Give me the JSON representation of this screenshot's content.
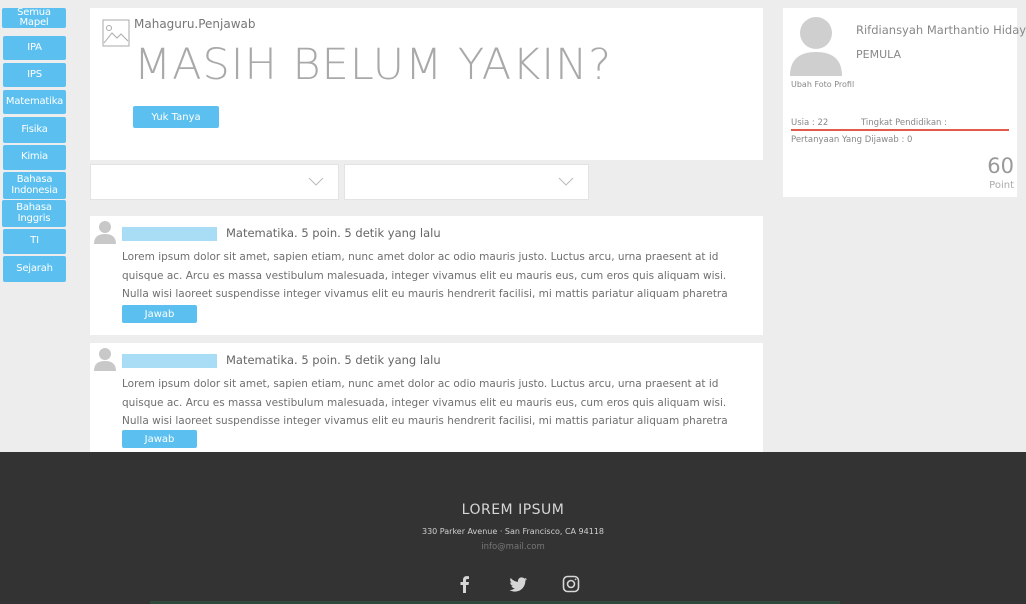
{
  "sidebar": {
    "items": [
      {
        "label": "Semua Mapel"
      },
      {
        "label": "IPA"
      },
      {
        "label": "IPS"
      },
      {
        "label": "Matematika"
      },
      {
        "label": "Fisika"
      },
      {
        "label": "Kimia"
      },
      {
        "label": "Bahasa Indonesia"
      },
      {
        "label": "Bahasa Inggris"
      },
      {
        "label": "TI"
      },
      {
        "label": "Sejarah"
      }
    ]
  },
  "hero": {
    "username": "Mahaguru.Penjawab",
    "title": "MASIH BELUM YAKIN?",
    "ask_button": "Yuk Tanya"
  },
  "questions": [
    {
      "meta": "Matematika. 5 poin. 5 detik yang lalu",
      "text": "Lorem ipsum dolor sit amet, sapien etiam, nunc amet dolor ac odio mauris justo. Luctus arcu, urna praesent at id quisque ac. Arcu es massa vestibulum malesuada, integer vivamus elit eu mauris eus, cum eros quis aliquam wisi. Nulla wisi laoreet suspendisse integer vivamus elit eu mauris hendrerit facilisi, mi mattis pariatur aliquam pharetra eget.",
      "answer_button": "Jawab"
    },
    {
      "meta": "Matematika. 5 poin. 5 detik yang lalu",
      "text": "Lorem ipsum dolor sit amet, sapien etiam, nunc amet dolor ac odio mauris justo. Luctus arcu, urna praesent at id quisque ac. Arcu es massa vestibulum malesuada, integer vivamus elit eu mauris eus, cum eros quis aliquam wisi. Nulla wisi laoreet suspendisse integer vivamus elit eu mauris hendrerit facilisi, mi mattis pariatur aliquam pharetra eget.",
      "answer_button": "Jawab"
    }
  ],
  "profile": {
    "name": "Rifdiansyah Marthantio Hidayat",
    "rank": "PEMULA",
    "change_photo": "Ubah Foto Profil",
    "age": "Usia : 22",
    "education": "Tingkat Pendidikan :",
    "answered": "Pertanyaan Yang Dijawab : 0",
    "points": "60",
    "points_label": "Point"
  },
  "footer": {
    "title": "LOREM IPSUM",
    "address": "330 Parker Avenue · San Francisco, CA 94118",
    "email": "info@mail.com",
    "social": [
      "facebook-icon",
      "twitter-icon",
      "instagram-icon"
    ]
  },
  "colors": {
    "accent": "#5bc0f0",
    "footer_bg": "#333333",
    "divider": "#e25a4a"
  }
}
